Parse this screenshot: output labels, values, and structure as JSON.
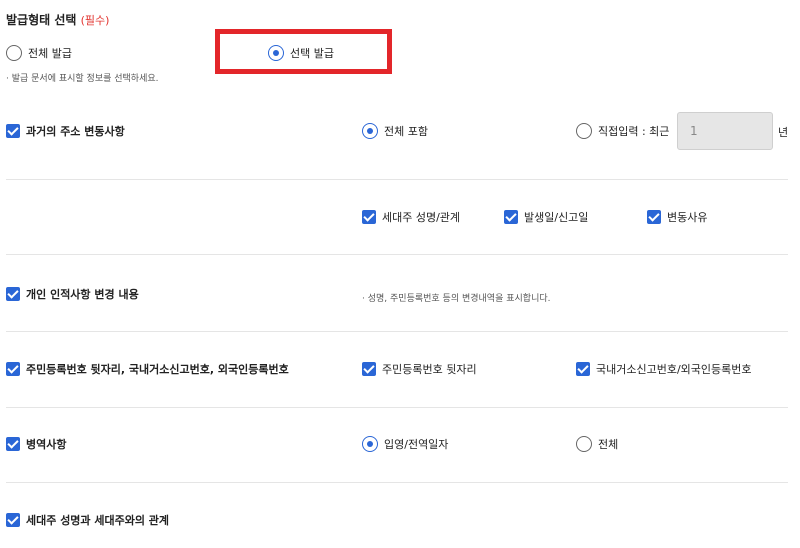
{
  "header": {
    "title": "발급형태 선택",
    "required": "(필수)"
  },
  "issue_type": {
    "all_label": "전체 발급",
    "selected_label": "선택 발급",
    "hint": "· 발급 문서에 표시할 정보를 선택하세요."
  },
  "address_history": {
    "label": "과거의 주소 변동사항",
    "include_all": "전체 포함",
    "direct_input": "직접입력 : 최근",
    "input_value": "1",
    "unit": "년",
    "sub_options": [
      "세대주 성명/관계",
      "발생일/신고일",
      "변동사유"
    ]
  },
  "personal_change": {
    "label": "개인 인적사항 변경 내용",
    "hint": "· 성명, 주민등록번호 등의 변경내역을 표시합니다."
  },
  "id_numbers": {
    "label": "주민등록번호 뒷자리, 국내거소신고번호, 외국인등록번호",
    "opt1": "주민등록번호 뒷자리",
    "opt2": "국내거소신고번호/외국인등록번호"
  },
  "military": {
    "label": "병역사항",
    "opt1": "입영/전역일자",
    "opt2": "전체"
  },
  "householder": {
    "label": "세대주 성명과 세대주와의 관계"
  }
}
